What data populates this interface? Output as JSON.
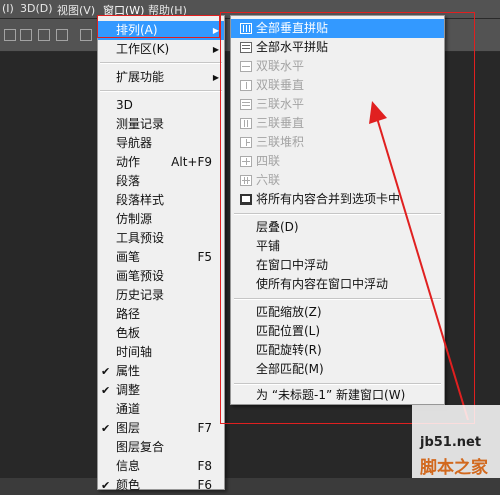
{
  "menubar": {
    "items": [
      {
        "label": "(I)"
      },
      {
        "label": "3D(D)"
      },
      {
        "label": "视图(V)"
      },
      {
        "label": "窗口(W)"
      },
      {
        "label": "帮助(H)"
      }
    ]
  },
  "window_menu": {
    "items": [
      {
        "label": "排列(A)",
        "submenu": true,
        "highlighted": true
      },
      {
        "label": "工作区(K)",
        "submenu": true
      },
      {
        "label": "扩展功能",
        "submenu": true
      },
      {
        "label": "3D"
      },
      {
        "label": "测量记录"
      },
      {
        "label": "导航器"
      },
      {
        "label": "动作",
        "shortcut": "Alt+F9"
      },
      {
        "label": "段落"
      },
      {
        "label": "段落样式"
      },
      {
        "label": "仿制源"
      },
      {
        "label": "工具预设"
      },
      {
        "label": "画笔",
        "shortcut": "F5"
      },
      {
        "label": "画笔预设"
      },
      {
        "label": "历史记录"
      },
      {
        "label": "路径"
      },
      {
        "label": "色板"
      },
      {
        "label": "时间轴"
      },
      {
        "label": "属性",
        "checked": true
      },
      {
        "label": "调整",
        "checked": true
      },
      {
        "label": "通道"
      },
      {
        "label": "图层",
        "shortcut": "F7",
        "checked": true
      },
      {
        "label": "图层复合"
      },
      {
        "label": "信息",
        "shortcut": "F8"
      },
      {
        "label": "颜色",
        "shortcut": "F6",
        "checked": true
      }
    ]
  },
  "arrange_menu": {
    "items": [
      {
        "label": "全部垂直拼贴",
        "icon": "tile-vertical-icon",
        "highlighted": true
      },
      {
        "label": "全部水平拼贴",
        "icon": "tile-horizontal-icon"
      },
      {
        "label": "双联水平",
        "icon": "two-up-horizontal-icon",
        "disabled": true
      },
      {
        "label": "双联垂直",
        "icon": "two-up-vertical-icon",
        "disabled": true
      },
      {
        "label": "三联水平",
        "icon": "three-up-horizontal-icon",
        "disabled": true
      },
      {
        "label": "三联垂直",
        "icon": "three-up-vertical-icon",
        "disabled": true
      },
      {
        "label": "三联堆积",
        "icon": "three-up-stacked-icon",
        "disabled": true
      },
      {
        "label": "四联",
        "icon": "four-up-icon",
        "disabled": true
      },
      {
        "label": "六联",
        "icon": "six-up-icon",
        "disabled": true
      },
      {
        "label": "将所有内容合并到选项卡中",
        "icon": "consolidate-tabs-icon"
      },
      {
        "label": "层叠(D)"
      },
      {
        "label": "平铺"
      },
      {
        "label": "在窗口中浮动"
      },
      {
        "label": "使所有内容在窗口中浮动"
      },
      {
        "label": "匹配缩放(Z)"
      },
      {
        "label": "匹配位置(L)"
      },
      {
        "label": "匹配旋转(R)"
      },
      {
        "label": "全部匹配(M)"
      },
      {
        "label": "为 “未标题-1” 新建窗口(W)"
      }
    ]
  },
  "watermark": {
    "site": "jb51.net",
    "name": "脚本之家"
  },
  "colors": {
    "highlight": "#3399ff",
    "annotation": "#e02020"
  }
}
